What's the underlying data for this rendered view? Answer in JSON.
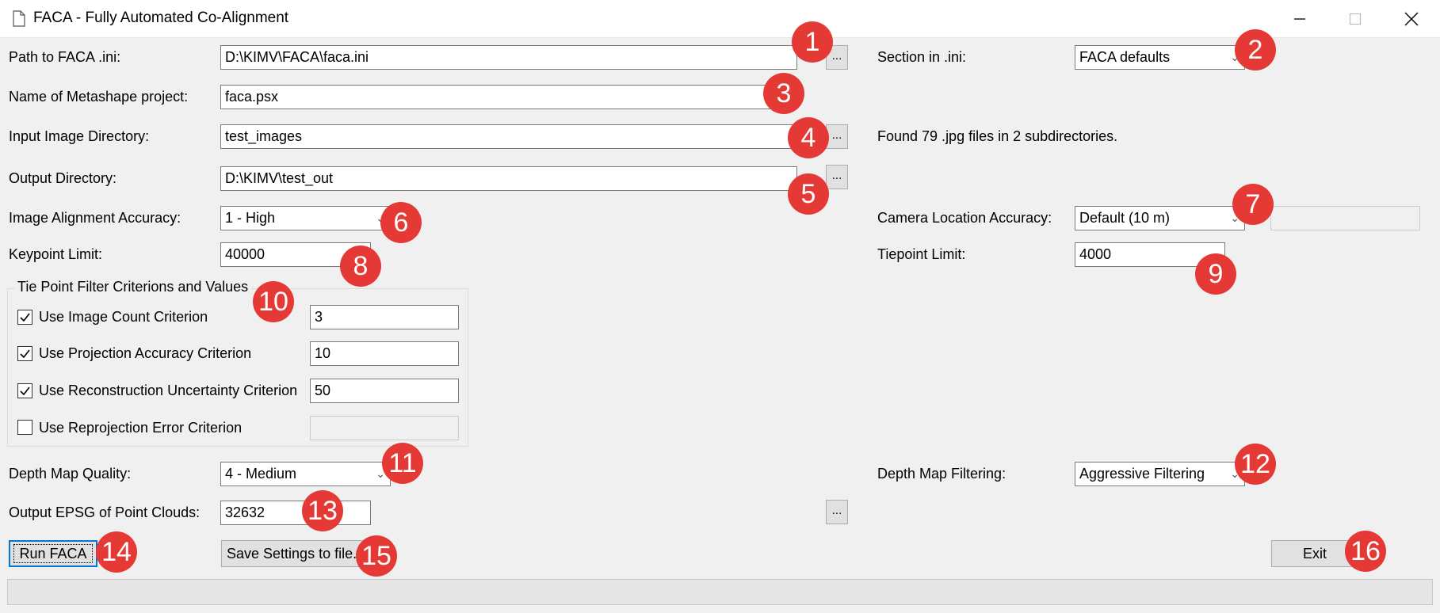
{
  "window": {
    "title": "FACA - Fully Automated Co-Alignment"
  },
  "form": {
    "ini_path": {
      "label": "Path to FACA .ini:",
      "value": "D:\\KIMV\\FACA\\faca.ini"
    },
    "ini_section": {
      "label": "Section in .ini:",
      "value": "FACA defaults"
    },
    "metashape_project": {
      "label": "Name of Metashape project:",
      "value": "faca.psx"
    },
    "input_dir": {
      "label": "Input Image Directory:",
      "value": "test_images"
    },
    "found_info": "Found 79 .jpg files in 2 subdirectories.",
    "output_dir": {
      "label": "Output Directory:",
      "value": "D:\\KIMV\\test_out"
    },
    "alignment_accuracy": {
      "label": "Image Alignment Accuracy:",
      "value": "1 - High"
    },
    "camera_location_accuracy": {
      "label": "Camera Location Accuracy:",
      "value": "Default (10 m)"
    },
    "keypoint_limit": {
      "label": "Keypoint Limit:",
      "value": "40000"
    },
    "tiepoint_limit": {
      "label": "Tiepoint Limit:",
      "value": "4000"
    },
    "depth_map_quality": {
      "label": "Depth Map Quality:",
      "value": "4 - Medium"
    },
    "depth_map_filtering": {
      "label": "Depth Map Filtering:",
      "value": "Aggressive Filtering"
    },
    "output_epsg": {
      "label": "Output EPSG of Point Clouds:",
      "value": "32632"
    },
    "browse_label": "..."
  },
  "filters": {
    "title": "Tie Point Filter Criterions and Values",
    "items": [
      {
        "label": "Use Image Count Criterion",
        "checked": true,
        "value": "3"
      },
      {
        "label": "Use Projection Accuracy Criterion",
        "checked": true,
        "value": "10"
      },
      {
        "label": "Use Reconstruction Uncertainty Criterion",
        "checked": true,
        "value": "50"
      },
      {
        "label": "Use Reprojection Error Criterion",
        "checked": false,
        "value": ""
      }
    ]
  },
  "actions": {
    "run": "Run FACA",
    "save": "Save Settings to file...",
    "exit": "Exit"
  },
  "markers": [
    "1",
    "2",
    "3",
    "4",
    "5",
    "6",
    "7",
    "8",
    "9",
    "10",
    "11",
    "12",
    "13",
    "14",
    "15",
    "16"
  ],
  "colors": {
    "marker": "#e53935",
    "focus_border": "#0078d7",
    "window_bg": "#f0f0f0"
  }
}
